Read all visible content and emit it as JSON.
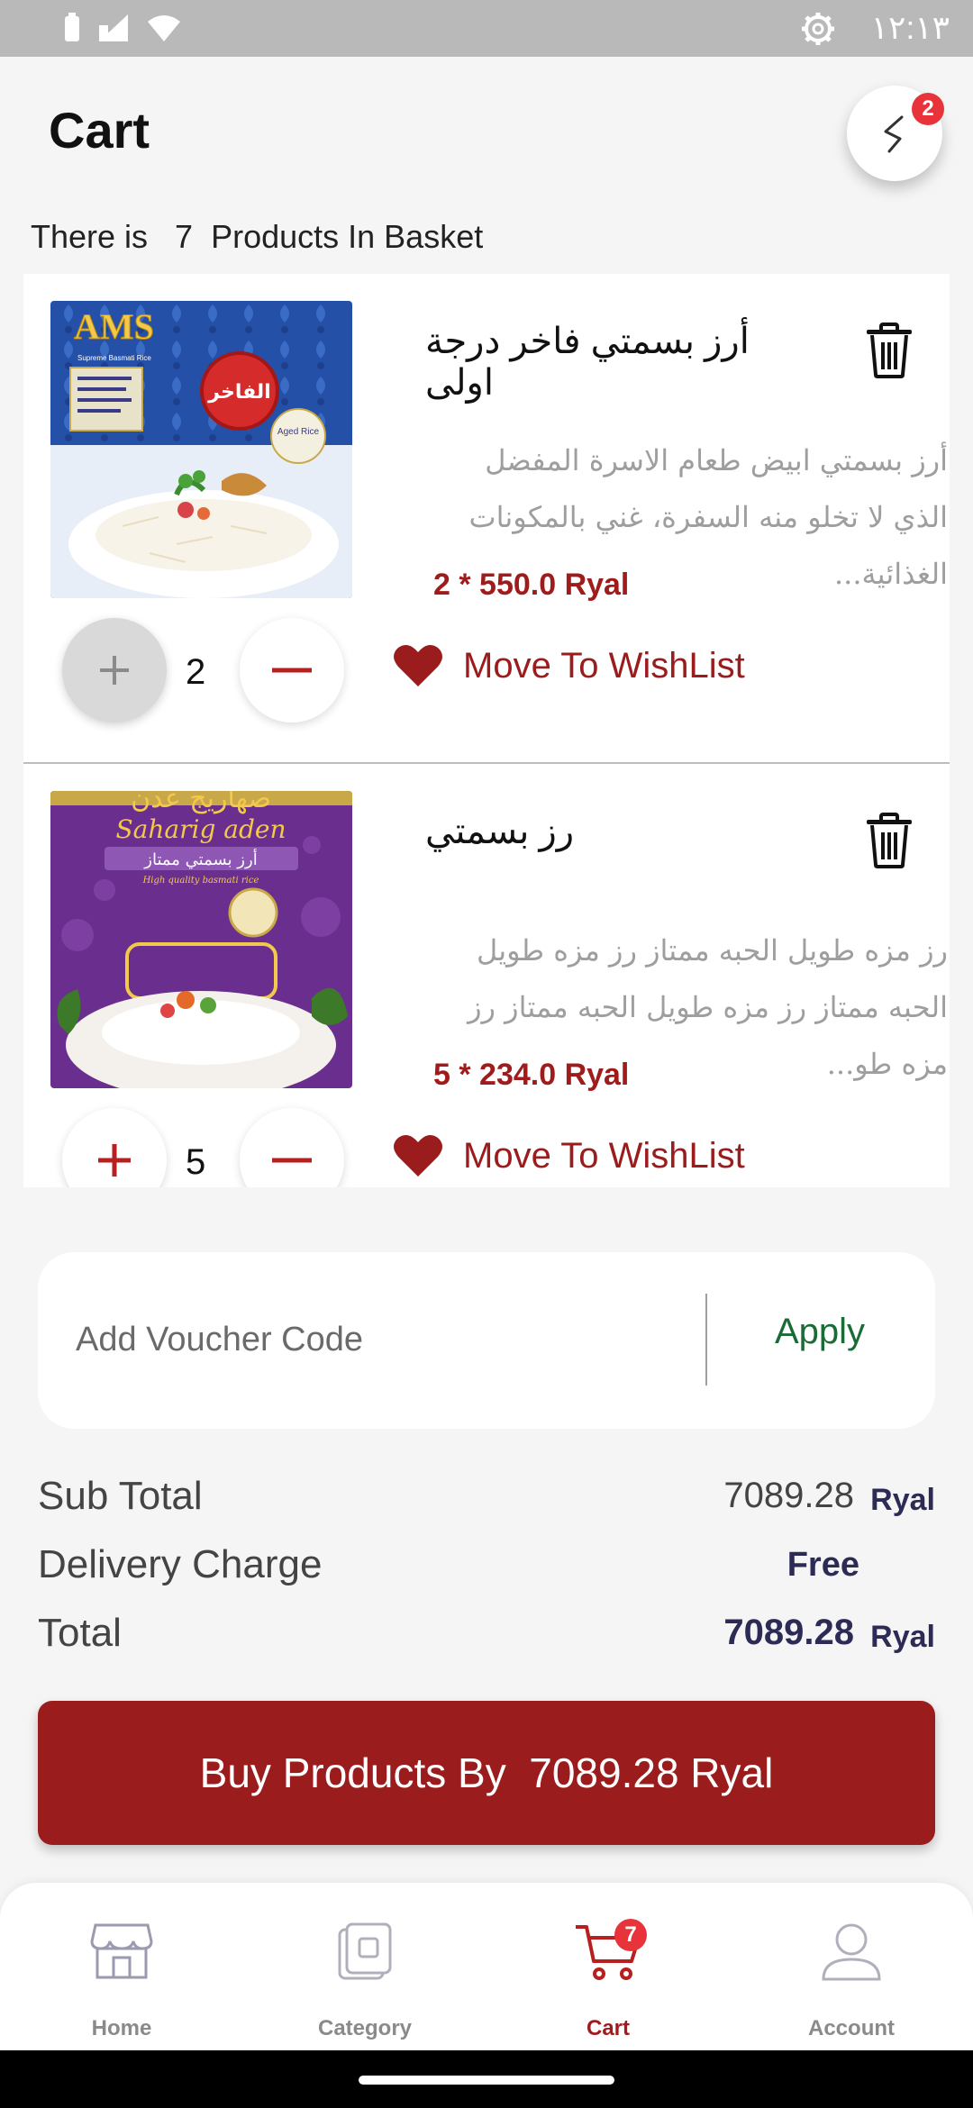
{
  "status_bar": {
    "time": "١٢:١٣",
    "icons": [
      "battery-icon",
      "signal-icon",
      "wifi-icon",
      "settings-gear-icon"
    ]
  },
  "header": {
    "title": "Cart",
    "back_badge": "2"
  },
  "basket": {
    "text": "There is   7  Products In Basket"
  },
  "items": [
    {
      "name": "أرز بسمتي فاخر درجة اولى",
      "description": "أرز بسمتي ابيض طعام الاسرة المفضل الذي لا تخلو منه السفرة، غني بالمكونات الغذائية...",
      "price": "2 * 550.0 Ryal",
      "quantity": "2",
      "wishlist_label": "Move To WishList",
      "image_texts": {
        "brand": "AMS",
        "badge": "الفاخر",
        "subtitle": "Supreme Basmati Rice",
        "aged": "Aged Rice"
      }
    },
    {
      "name": "رز بسمتي",
      "description": "رز مزه طويل الحبه ممتاز رز مزه طويل الحبه ممتاز رز مزه طويل الحبه ممتاز رز مزه طو...",
      "price": "5 * 234.0 Ryal",
      "quantity": "5",
      "wishlist_label": "Move To WishList",
      "image_texts": {
        "brand_ar": "صهاريج عدن",
        "brand": "Saharig aden",
        "subtitle_ar": "أرز بسمتي ممتاز",
        "subtitle": "High quality basmati rice"
      }
    }
  ],
  "voucher": {
    "placeholder": "Add Voucher Code",
    "apply_label": "Apply"
  },
  "summary": {
    "sub_total_label": "Sub Total",
    "sub_total_value": "7089.28",
    "sub_total_unit": "Ryal",
    "delivery_label": "Delivery Charge",
    "delivery_value": "Free",
    "total_label": "Total",
    "total_value": "7089.28",
    "total_unit": "Ryal"
  },
  "buy_button": {
    "label": "Buy Products By  7089.28 Ryal"
  },
  "bottom_nav": [
    {
      "label": "Home",
      "icon": "store-icon",
      "active": false
    },
    {
      "label": "Category",
      "icon": "category-icon",
      "active": false
    },
    {
      "label": "Cart",
      "icon": "cart-icon",
      "active": true,
      "badge": "7"
    },
    {
      "label": "Account",
      "icon": "user-icon",
      "active": false
    }
  ],
  "colors": {
    "brand": "#9b1c1c",
    "apply": "#1b6b36",
    "badge": "#e8333a",
    "summary_text": "#2b2b55"
  }
}
